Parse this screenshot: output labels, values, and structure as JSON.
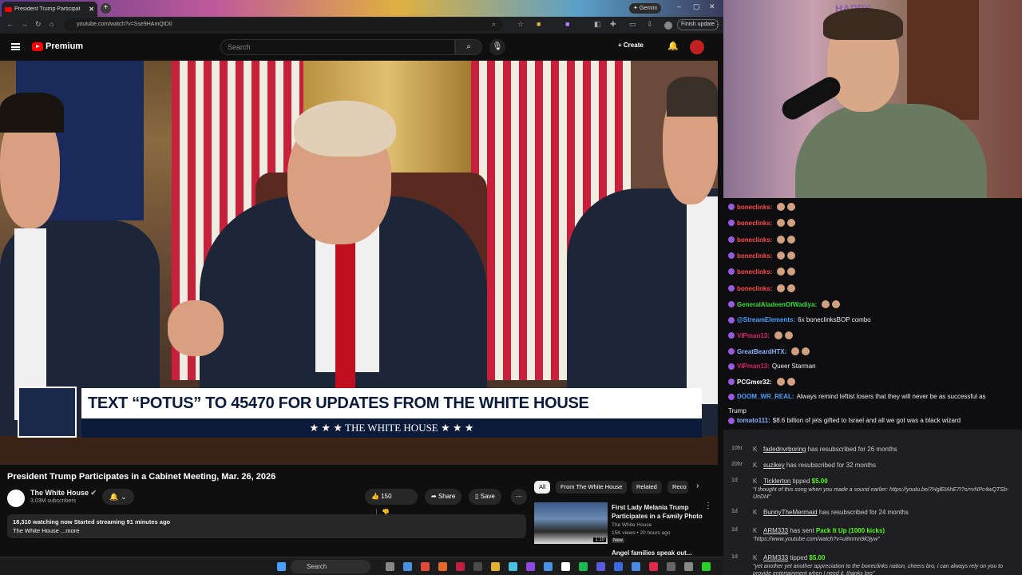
{
  "browser": {
    "tab_title": "President Trump Participat",
    "gemini": "Gemini",
    "url": "youtube.com/watch?v=Sse9HAmQtD0",
    "finish_update": "Finish update"
  },
  "youtube": {
    "brand": "Premium",
    "search_placeholder": "Search",
    "create_label": "Create",
    "video_title": "President Trump Participates in a Cabinet Meeting, Mar. 26, 2026",
    "channel_name": "The White House",
    "subscribers": "3.03M subscribers",
    "likes": "150",
    "share_label": "Share",
    "save_label": "Save",
    "description_line1": "18,310 watching now  Started streaming 91 minutes ago",
    "description_line2": "The White House ...more",
    "lower_third_main": "TEXT “POTUS” TO 45470 FOR UPDATES FROM THE WHITE HOUSE",
    "lower_third_sub": "★ ★ ★   THE WHITE HOUSE   ★ ★ ★",
    "chips": [
      "All",
      "From The White House",
      "Related",
      "Reco"
    ],
    "rec_video": {
      "title_line1": "First Lady Melania Trump",
      "title_line2": "Participates in a Family Photo",
      "channel": "The White House",
      "meta": "15K views • 20 hours ago",
      "badge": "New",
      "duration": "1:10"
    },
    "rec_video2_title": "Angel families speak out..."
  },
  "taskbar": {
    "search": "Search"
  },
  "chat": [
    {
      "user": "boneclinks:",
      "color": "#ff4a4a",
      "text": ""
    },
    {
      "user": "boneclinks:",
      "color": "#ff4a4a",
      "text": ""
    },
    {
      "user": "boneclinks:",
      "color": "#ff4a4a",
      "text": ""
    },
    {
      "user": "boneclinks:",
      "color": "#ff4a4a",
      "text": ""
    },
    {
      "user": "boneclinks:",
      "color": "#ff4a4a",
      "text": ""
    },
    {
      "user": "boneclinks:",
      "color": "#ff4a4a",
      "text": ""
    },
    {
      "user": "GeneralAladeenOfWadiya:",
      "color": "#3ad83a",
      "text": ""
    },
    {
      "user": "@StreamElements:",
      "color": "#4aa0ff",
      "text": "6x boneclinksBOP combo"
    },
    {
      "user": "VIPman13:",
      "color": "#e0206a",
      "text": ""
    },
    {
      "user": "GreatBeardHTX:",
      "color": "#8ab0ff",
      "text": ""
    },
    {
      "user": "VIPman13:",
      "color": "#e0206a",
      "text": "Queer Starman"
    },
    {
      "user": "PCGmer32:",
      "color": "#ffffff",
      "text": ""
    },
    {
      "user": "DOOM_WR_REAL:",
      "color": "#4aa0ff",
      "text": "Always remind leftist losers that they will never be as successful as"
    },
    {
      "user": "",
      "color": "#efeff1",
      "text": "Trump"
    },
    {
      "user": "tomato111:",
      "color": "#8ab0ff",
      "text": "$8.6 billion of jets gifted to Israel and all we got was a black wizard"
    }
  ],
  "events": [
    {
      "time": "10hr",
      "user": "fadednvrboring",
      "text": " has resubscribed for 26 months"
    },
    {
      "time": "20hr",
      "user": "suzikey",
      "text": " has resubscribed for 32 months"
    },
    {
      "time": "1d",
      "user": "Ticklerton",
      "text": " tipped ",
      "amount": "$5.00",
      "quote": "\"I thought of this song when you made a sound earlier: https://youtu.be/7HglEtAhE7I?si=vNPc4wQTSb-UnDI4\""
    },
    {
      "time": "1d",
      "user": "BunnyTheMermaid",
      "text": " has resubscribed for 24 months"
    },
    {
      "time": "1d",
      "user": "ARM333",
      "text": " has sent ",
      "amount": "Pack It Up (1000 kicks)",
      "quote": "\"https://www.youtube.com/watch?v=u8mmn9lOjyw\""
    },
    {
      "time": "1d",
      "user": "ARM333",
      "text": " tipped ",
      "amount": "$5.00",
      "quote": "\"yet another yet another appreciation to the boneclinks nation, cheers bro, i can always rely on you to provide entertainment when I need it, thanks bro\""
    }
  ],
  "stream_overlay_text": "HAPPY EASTER"
}
